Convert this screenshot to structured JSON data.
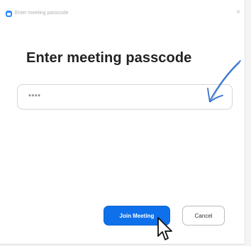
{
  "window": {
    "title": "Enter meeting passcode",
    "app_icon": "zoom-camera-icon",
    "close_glyph": "×"
  },
  "dialog": {
    "heading": "Enter meeting passcode",
    "passcode_value": "****",
    "join_label": "Join Meeting",
    "cancel_label": "Cancel"
  },
  "annotation": {
    "icon": "hand-drawn-arrow-icon",
    "color": "#2e6ec9"
  },
  "pointer": {
    "icon": "mouse-cursor-icon"
  },
  "colors": {
    "primary_button": "#0e71eb",
    "app_icon": "#2d8cff"
  }
}
